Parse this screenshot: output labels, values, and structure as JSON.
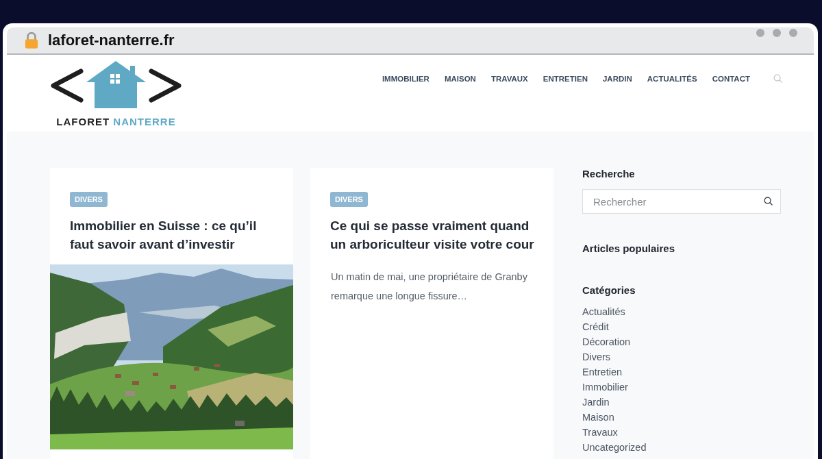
{
  "browser": {
    "url": "laforet-nanterre.fr"
  },
  "site": {
    "logo": {
      "name_first": "LAFORET",
      "name_second": "NANTERRE"
    },
    "nav": [
      {
        "label": "IMMOBILIER",
        "selected": false
      },
      {
        "label": "MAISON",
        "selected": false
      },
      {
        "label": "TRAVAUX",
        "selected": false
      },
      {
        "label": "ENTRETIEN",
        "selected": false
      },
      {
        "label": "JARDIN",
        "selected": false
      },
      {
        "label": "ACTUALITÉS",
        "selected": false
      },
      {
        "label": "CONTACT",
        "selected": false
      }
    ]
  },
  "posts": [
    {
      "kind": "image",
      "category": "DIVERS",
      "title": "Immobilier en Suisse : ce qu’il faut savoir avant d’investir"
    },
    {
      "kind": "excerpt",
      "category": "DIVERS",
      "title": "Ce qui se passe vraiment quand un arboriculteur visite votre cour",
      "excerpt": "Un matin de mai, une propriétaire de Granby remarque une longue fissure…"
    }
  ],
  "sidebar": {
    "search": {
      "heading": "Recherche",
      "placeholder": "Rechercher"
    },
    "popular": {
      "heading": "Articles populaires"
    },
    "categories": {
      "heading": "Catégories",
      "items": [
        "Actualités",
        "Crédit",
        "Décoration",
        "Divers",
        "Entretien",
        "Immobilier",
        "Jardin",
        "Maison",
        "Travaux",
        "Uncategorized"
      ]
    }
  }
}
